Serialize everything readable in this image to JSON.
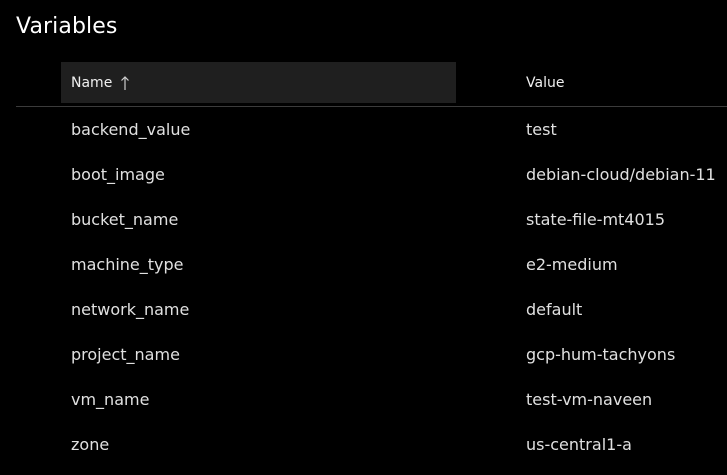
{
  "panel": {
    "title": "Variables"
  },
  "table": {
    "columns": {
      "name_label": "Name",
      "value_label": "Value"
    },
    "sort": {
      "column": "Name",
      "direction": "ascending",
      "icon": "arrow-up-icon"
    },
    "rows": [
      {
        "name": "backend_value",
        "value": "test"
      },
      {
        "name": "boot_image",
        "value": "debian-cloud/debian-11"
      },
      {
        "name": "bucket_name",
        "value": "state-file-mt4015"
      },
      {
        "name": "machine_type",
        "value": "e2-medium"
      },
      {
        "name": "network_name",
        "value": "default"
      },
      {
        "name": "project_name",
        "value": "gcp-hum-tachyons"
      },
      {
        "name": "vm_name",
        "value": "test-vm-naveen"
      },
      {
        "name": "zone",
        "value": "us-central1-a"
      }
    ]
  },
  "colors": {
    "background": "#000000",
    "header_highlight": "#1f1f1f",
    "divider": "#3b3b3b",
    "text": "#e0e0e0"
  }
}
